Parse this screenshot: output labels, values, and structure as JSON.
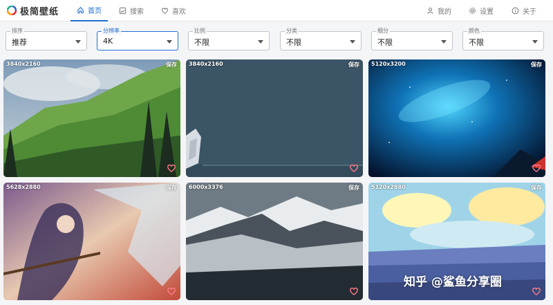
{
  "app": {
    "name": "极简壁纸"
  },
  "nav": {
    "left": [
      {
        "label": "首页",
        "icon": "home-icon",
        "active": true
      },
      {
        "label": "搜索",
        "icon": "image-search-icon"
      },
      {
        "label": "喜欢",
        "icon": "heart-outline-icon"
      }
    ],
    "right": [
      {
        "label": "我的",
        "icon": "user-icon"
      },
      {
        "label": "设置",
        "icon": "gear-icon"
      },
      {
        "label": "关于",
        "icon": "info-icon"
      }
    ]
  },
  "filters": [
    {
      "label": "排序",
      "value": "推荐"
    },
    {
      "label": "分辨率",
      "value": "4K",
      "focused": true
    },
    {
      "label": "比例",
      "value": "不限"
    },
    {
      "label": "分类",
      "value": "不限"
    },
    {
      "label": "细分",
      "value": "不限"
    },
    {
      "label": "颜色",
      "value": "不限"
    }
  ],
  "cards": [
    {
      "resolution": "3840x2160",
      "save_label": "保存",
      "heart_color": "#ff7a8a"
    },
    {
      "resolution": "3840x2160",
      "save_label": "保存",
      "heart_color": "#ff7a8a"
    },
    {
      "resolution": "5120x3200",
      "save_label": "保存",
      "heart_color": "#ff7a8a"
    },
    {
      "resolution": "5628x2880",
      "save_label": "保存",
      "heart_color": "#ff7a8a"
    },
    {
      "resolution": "6000x3376",
      "save_label": "保存",
      "heart_color": "#ff7a8a"
    },
    {
      "resolution": "5120x2880",
      "save_label": "保存",
      "heart_color": "#ff7a8a"
    }
  ],
  "watermark": "知乎 @鲨鱼分享圈",
  "colors": {
    "accent": "#1f6fcf"
  }
}
